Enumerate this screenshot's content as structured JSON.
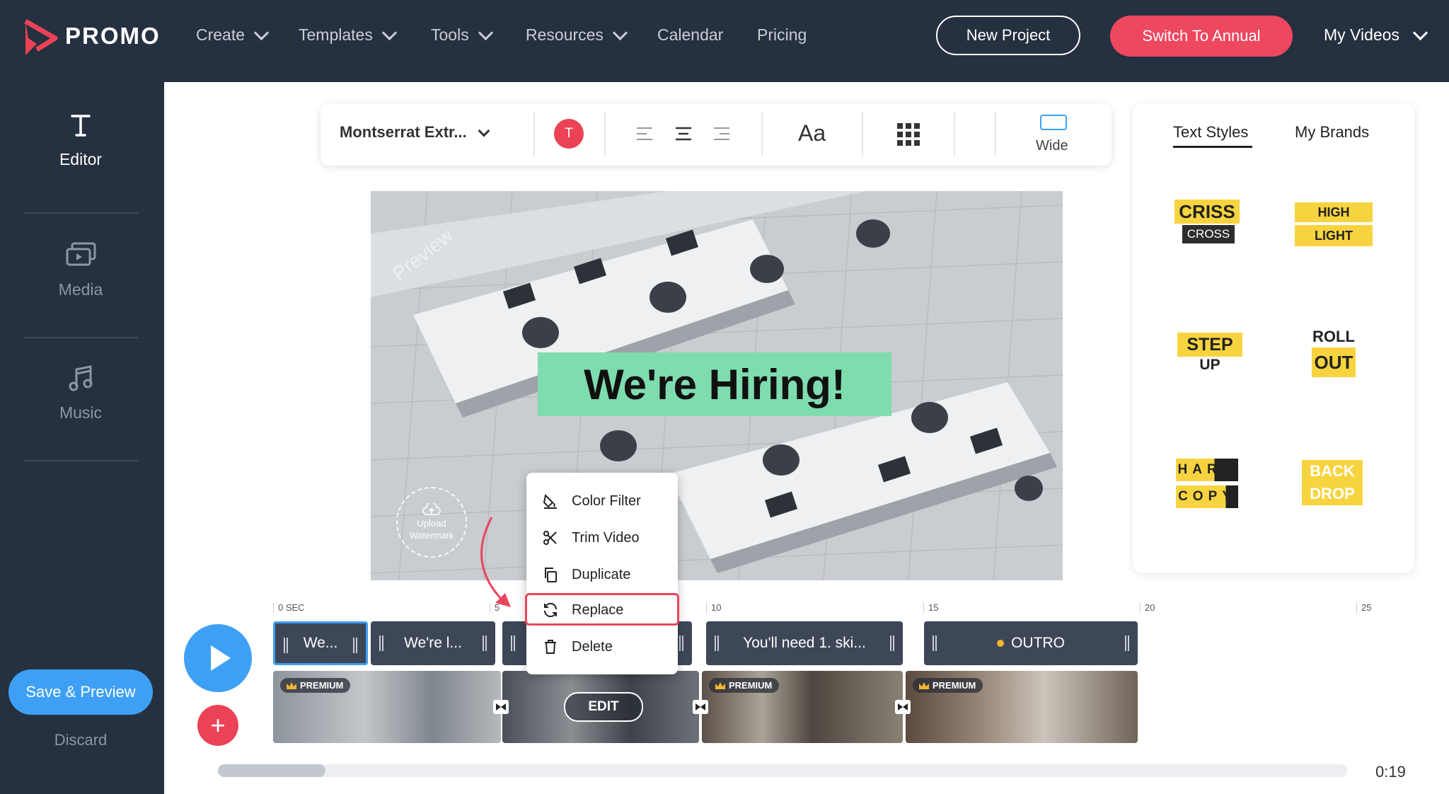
{
  "brand": {
    "name": "PROMO",
    "accent": "#ec4256"
  },
  "nav": {
    "items": [
      "Create",
      "Templates",
      "Tools",
      "Resources",
      "Calendar",
      "Pricing"
    ],
    "new_project": "New Project",
    "switch_annual": "Switch To Annual",
    "my_videos": "My Videos"
  },
  "sidebar": {
    "items": [
      {
        "label": "Editor",
        "icon": "text-t-icon",
        "active": true
      },
      {
        "label": "Media",
        "icon": "media-icon",
        "active": false
      },
      {
        "label": "Music",
        "icon": "music-note-icon",
        "active": false
      }
    ],
    "save_preview": "Save & Preview",
    "discard": "Discard"
  },
  "toolbar": {
    "font": "Montserrat Extr...",
    "color_letter": "T",
    "text_size_label": "Aa",
    "aspect_label": "Wide"
  },
  "preview": {
    "headline": "We're Hiring!",
    "stamp": "Preview",
    "watermark_line1": "Upload",
    "watermark_line2": "Watermark"
  },
  "styles_panel": {
    "tab_text_styles": "Text Styles",
    "tab_my_brands": "My Brands",
    "styles": [
      {
        "line1": "CRISS",
        "line2": "CROSS"
      },
      {
        "line1": "HIGH",
        "line2": "LIGHT"
      },
      {
        "line1": "STEP",
        "line2": "UP"
      },
      {
        "line1": "ROLL",
        "line2": "OUT"
      },
      {
        "line1": "HARD",
        "line2": "COPY"
      },
      {
        "line1": "BACK",
        "line2": "DROP"
      }
    ]
  },
  "timeline": {
    "ticks": [
      "0 SEC",
      "5",
      "10",
      "15",
      "20",
      "25"
    ],
    "text_clips": [
      "We...",
      "We're l...",
      "You'll need 1. ski...",
      "OUTRO"
    ],
    "premium_label": "PREMIUM",
    "edit_label": "EDIT",
    "duration": "0:19"
  },
  "context_menu": {
    "items": [
      "Color Filter",
      "Trim Video",
      "Duplicate",
      "Replace",
      "Delete"
    ],
    "highlighted": "Replace"
  }
}
